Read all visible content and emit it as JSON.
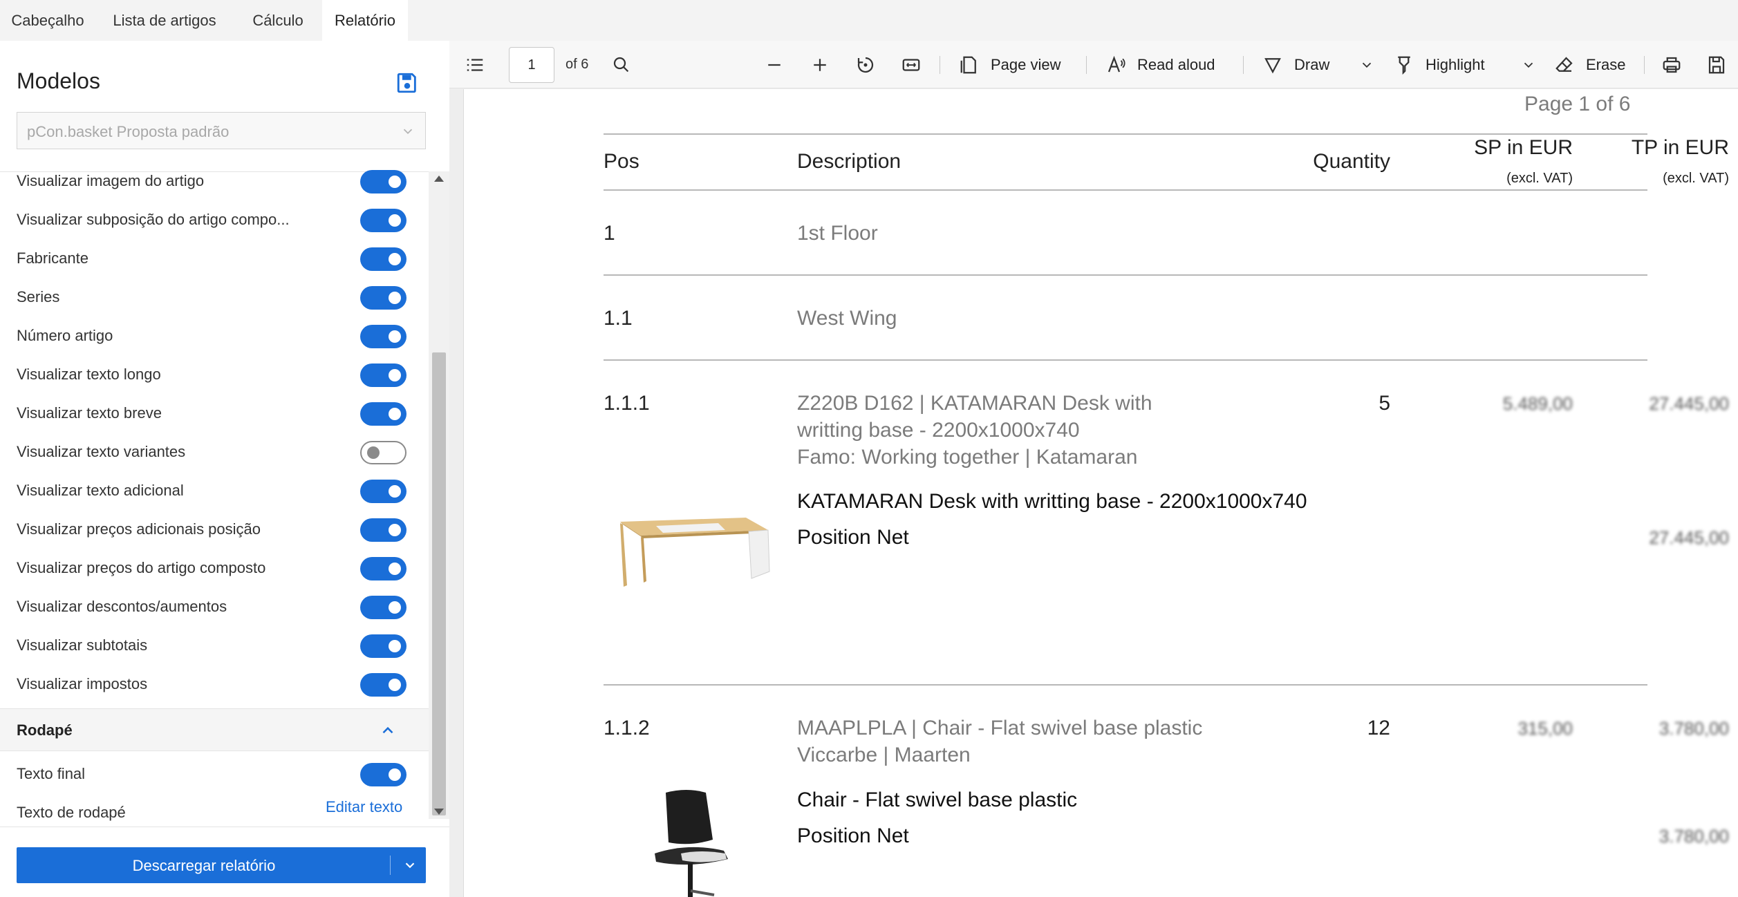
{
  "tabs": [
    {
      "label": "Cabeçalho",
      "active": false
    },
    {
      "label": "Lista de artigos",
      "active": false
    },
    {
      "label": "Cálculo",
      "active": false
    },
    {
      "label": "Relatório",
      "active": true
    }
  ],
  "left_panel": {
    "title": "Modelos",
    "template_select": "pCon.basket Proposta padrão",
    "options": [
      {
        "label": "Visualizar imagem do artigo",
        "on": true
      },
      {
        "label": "Visualizar subposição do artigo compo...",
        "on": true
      },
      {
        "label": "Fabricante",
        "on": true
      },
      {
        "label": "Series",
        "on": true
      },
      {
        "label": "Número artigo",
        "on": true
      },
      {
        "label": "Visualizar texto longo",
        "on": true
      },
      {
        "label": "Visualizar texto breve",
        "on": true
      },
      {
        "label": "Visualizar texto variantes",
        "on": false
      },
      {
        "label": "Visualizar texto adicional",
        "on": true
      },
      {
        "label": "Visualizar preços adicionais posição",
        "on": true
      },
      {
        "label": "Visualizar preços do artigo composto",
        "on": true
      },
      {
        "label": "Visualizar descontos/aumentos",
        "on": true
      },
      {
        "label": "Visualizar subtotais",
        "on": true
      },
      {
        "label": "Visualizar impostos",
        "on": true
      }
    ],
    "footer_section": {
      "label": "Rodapé",
      "final_text": {
        "label": "Texto final",
        "on": true
      },
      "footer_text": {
        "label": "Texto de rodapé",
        "action": "Editar texto"
      }
    },
    "download_button": "Descarregar relatório"
  },
  "viewer": {
    "toolbar": {
      "page_number": "1",
      "page_of": "of 6",
      "page_view": "Page view",
      "read_aloud": "Read aloud",
      "draw": "Draw",
      "highlight": "Highlight",
      "erase": "Erase"
    },
    "page": {
      "page_indicator": "Page  1  of  6",
      "columns": {
        "pos": "Pos",
        "description": "Description",
        "quantity": "Quantity",
        "sp": "SP in EUR",
        "sp_note": "(excl. VAT)",
        "tp": "TP in EUR",
        "tp_note": "(excl. VAT)"
      },
      "rows": [
        {
          "pos": "1",
          "description": "1st Floor"
        },
        {
          "pos": "1.1",
          "description": "West Wing"
        },
        {
          "pos": "1.1.1",
          "lines": [
            "Z220B D162 | KATAMARAN Desk with",
            "writting  base - 2200x1000x740",
            "Famo: Working together | Katamaran"
          ],
          "quantity": "5",
          "sp": "5.489,00",
          "tp": "27.445,00",
          "short_text": "KATAMARAN Desk with writting  base - 2200x1000x740",
          "position_net_label": "Position Net",
          "position_net": "27.445,00"
        },
        {
          "pos": "1.1.2",
          "lines": [
            "MAAPLPLA | Chair - Flat swivel base plastic",
            "Viccarbe | Maarten"
          ],
          "quantity": "12",
          "sp": "315,00",
          "tp": "3.780,00",
          "short_text": "Chair - Flat swivel base plastic",
          "position_net_label": "Position Net",
          "position_net": "3.780,00"
        }
      ]
    }
  },
  "colors": {
    "accent": "#1a6ed8",
    "toggle_off": "#8a8a8a",
    "tab_bar": "#f3f3f3"
  }
}
